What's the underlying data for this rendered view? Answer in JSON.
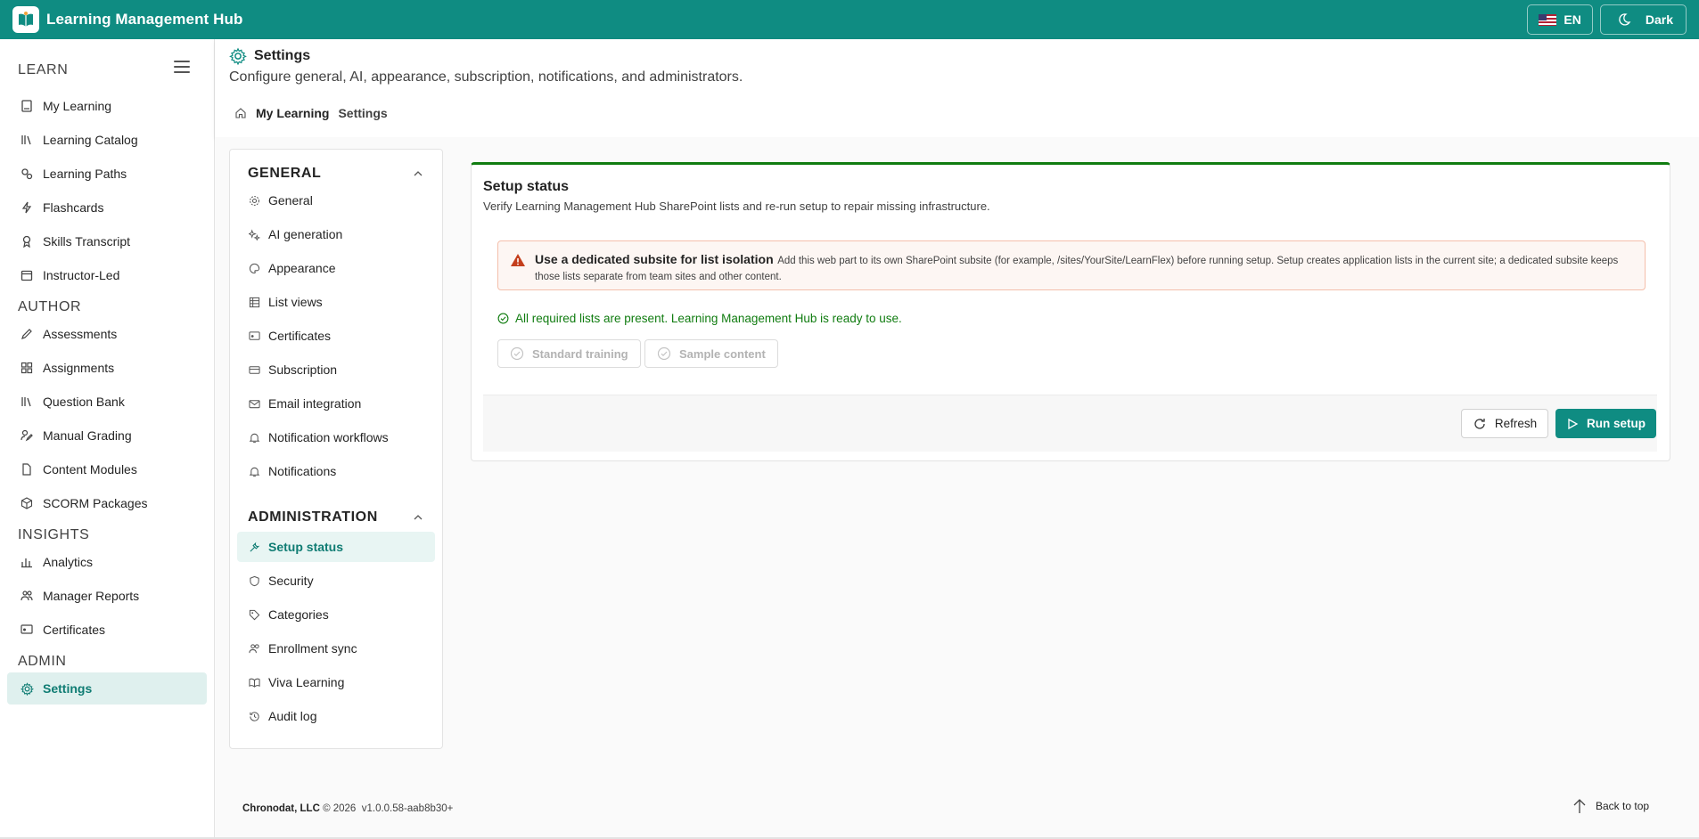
{
  "app": {
    "title": "Learning Management Hub"
  },
  "topbar": {
    "language": "EN",
    "theme": "Dark"
  },
  "sidebar": {
    "sections": [
      {
        "label": "LEARN"
      },
      {
        "label": "AUTHOR"
      },
      {
        "label": "INSIGHTS"
      },
      {
        "label": "ADMIN"
      }
    ],
    "items": [
      {
        "label": "My Learning",
        "icon": "book-icon"
      },
      {
        "label": "Learning Catalog",
        "icon": "library-icon"
      },
      {
        "label": "Learning Paths",
        "icon": "path-icon"
      },
      {
        "label": "Flashcards",
        "icon": "flash-icon"
      },
      {
        "label": "Skills Transcript",
        "icon": "ribbon-icon"
      },
      {
        "label": "Instructor-Led",
        "icon": "calendar-icon"
      },
      {
        "label": "Assessments",
        "icon": "pencil-icon"
      },
      {
        "label": "Assignments",
        "icon": "grid-icon"
      },
      {
        "label": "Question Bank",
        "icon": "library-icon"
      },
      {
        "label": "Manual Grading",
        "icon": "edit-person-icon"
      },
      {
        "label": "Content Modules",
        "icon": "document-icon"
      },
      {
        "label": "SCORM Packages",
        "icon": "cube-icon"
      },
      {
        "label": "Analytics",
        "icon": "chart-icon"
      },
      {
        "label": "Manager Reports",
        "icon": "people-icon"
      },
      {
        "label": "Certificates",
        "icon": "certificate-icon"
      },
      {
        "label": "Settings",
        "icon": "gear-icon",
        "active": true
      }
    ]
  },
  "header": {
    "title": "Settings",
    "subtitle": "Configure general, AI, appearance, subscription, notifications, and administrators.",
    "breadcrumb": [
      "My Learning",
      "Settings"
    ]
  },
  "settings_nav": {
    "groups": [
      {
        "label": "GENERAL",
        "items": [
          "General",
          "AI generation",
          "Appearance",
          "List views",
          "Certificates",
          "Subscription",
          "Email integration",
          "Notification workflows",
          "Notifications"
        ]
      },
      {
        "label": "ADMINISTRATION",
        "items": [
          "Setup status",
          "Security",
          "Categories",
          "Enrollment sync",
          "Viva Learning",
          "Audit log"
        ]
      }
    ],
    "active": "Setup status"
  },
  "card": {
    "title": "Setup status",
    "subtitle": "Verify Learning Management Hub SharePoint lists and re-run setup to repair missing infrastructure.",
    "warning_title": "Use a dedicated subsite for list isolation",
    "warning_body": "Add this web part to its own SharePoint subsite (for example, /sites/YourSite/LearnFlex) before running setup. Setup creates application lists in the current site; a dedicated subsite keeps those lists separate from team sites and other content.",
    "status": "All required lists are present. Learning Management Hub is ready to use.",
    "chips": [
      "Standard training",
      "Sample content"
    ],
    "refresh_label": "Refresh",
    "run_label": "Run setup"
  },
  "footer": {
    "company": "Chronodat, LLC",
    "copyright": "© 2026",
    "version": "v1.0.0.58-aab8b30+",
    "back_to_top": "Back to top"
  },
  "colors": {
    "brand": "#0f8c82",
    "success": "#107c10",
    "warning": "#c43e1c"
  }
}
